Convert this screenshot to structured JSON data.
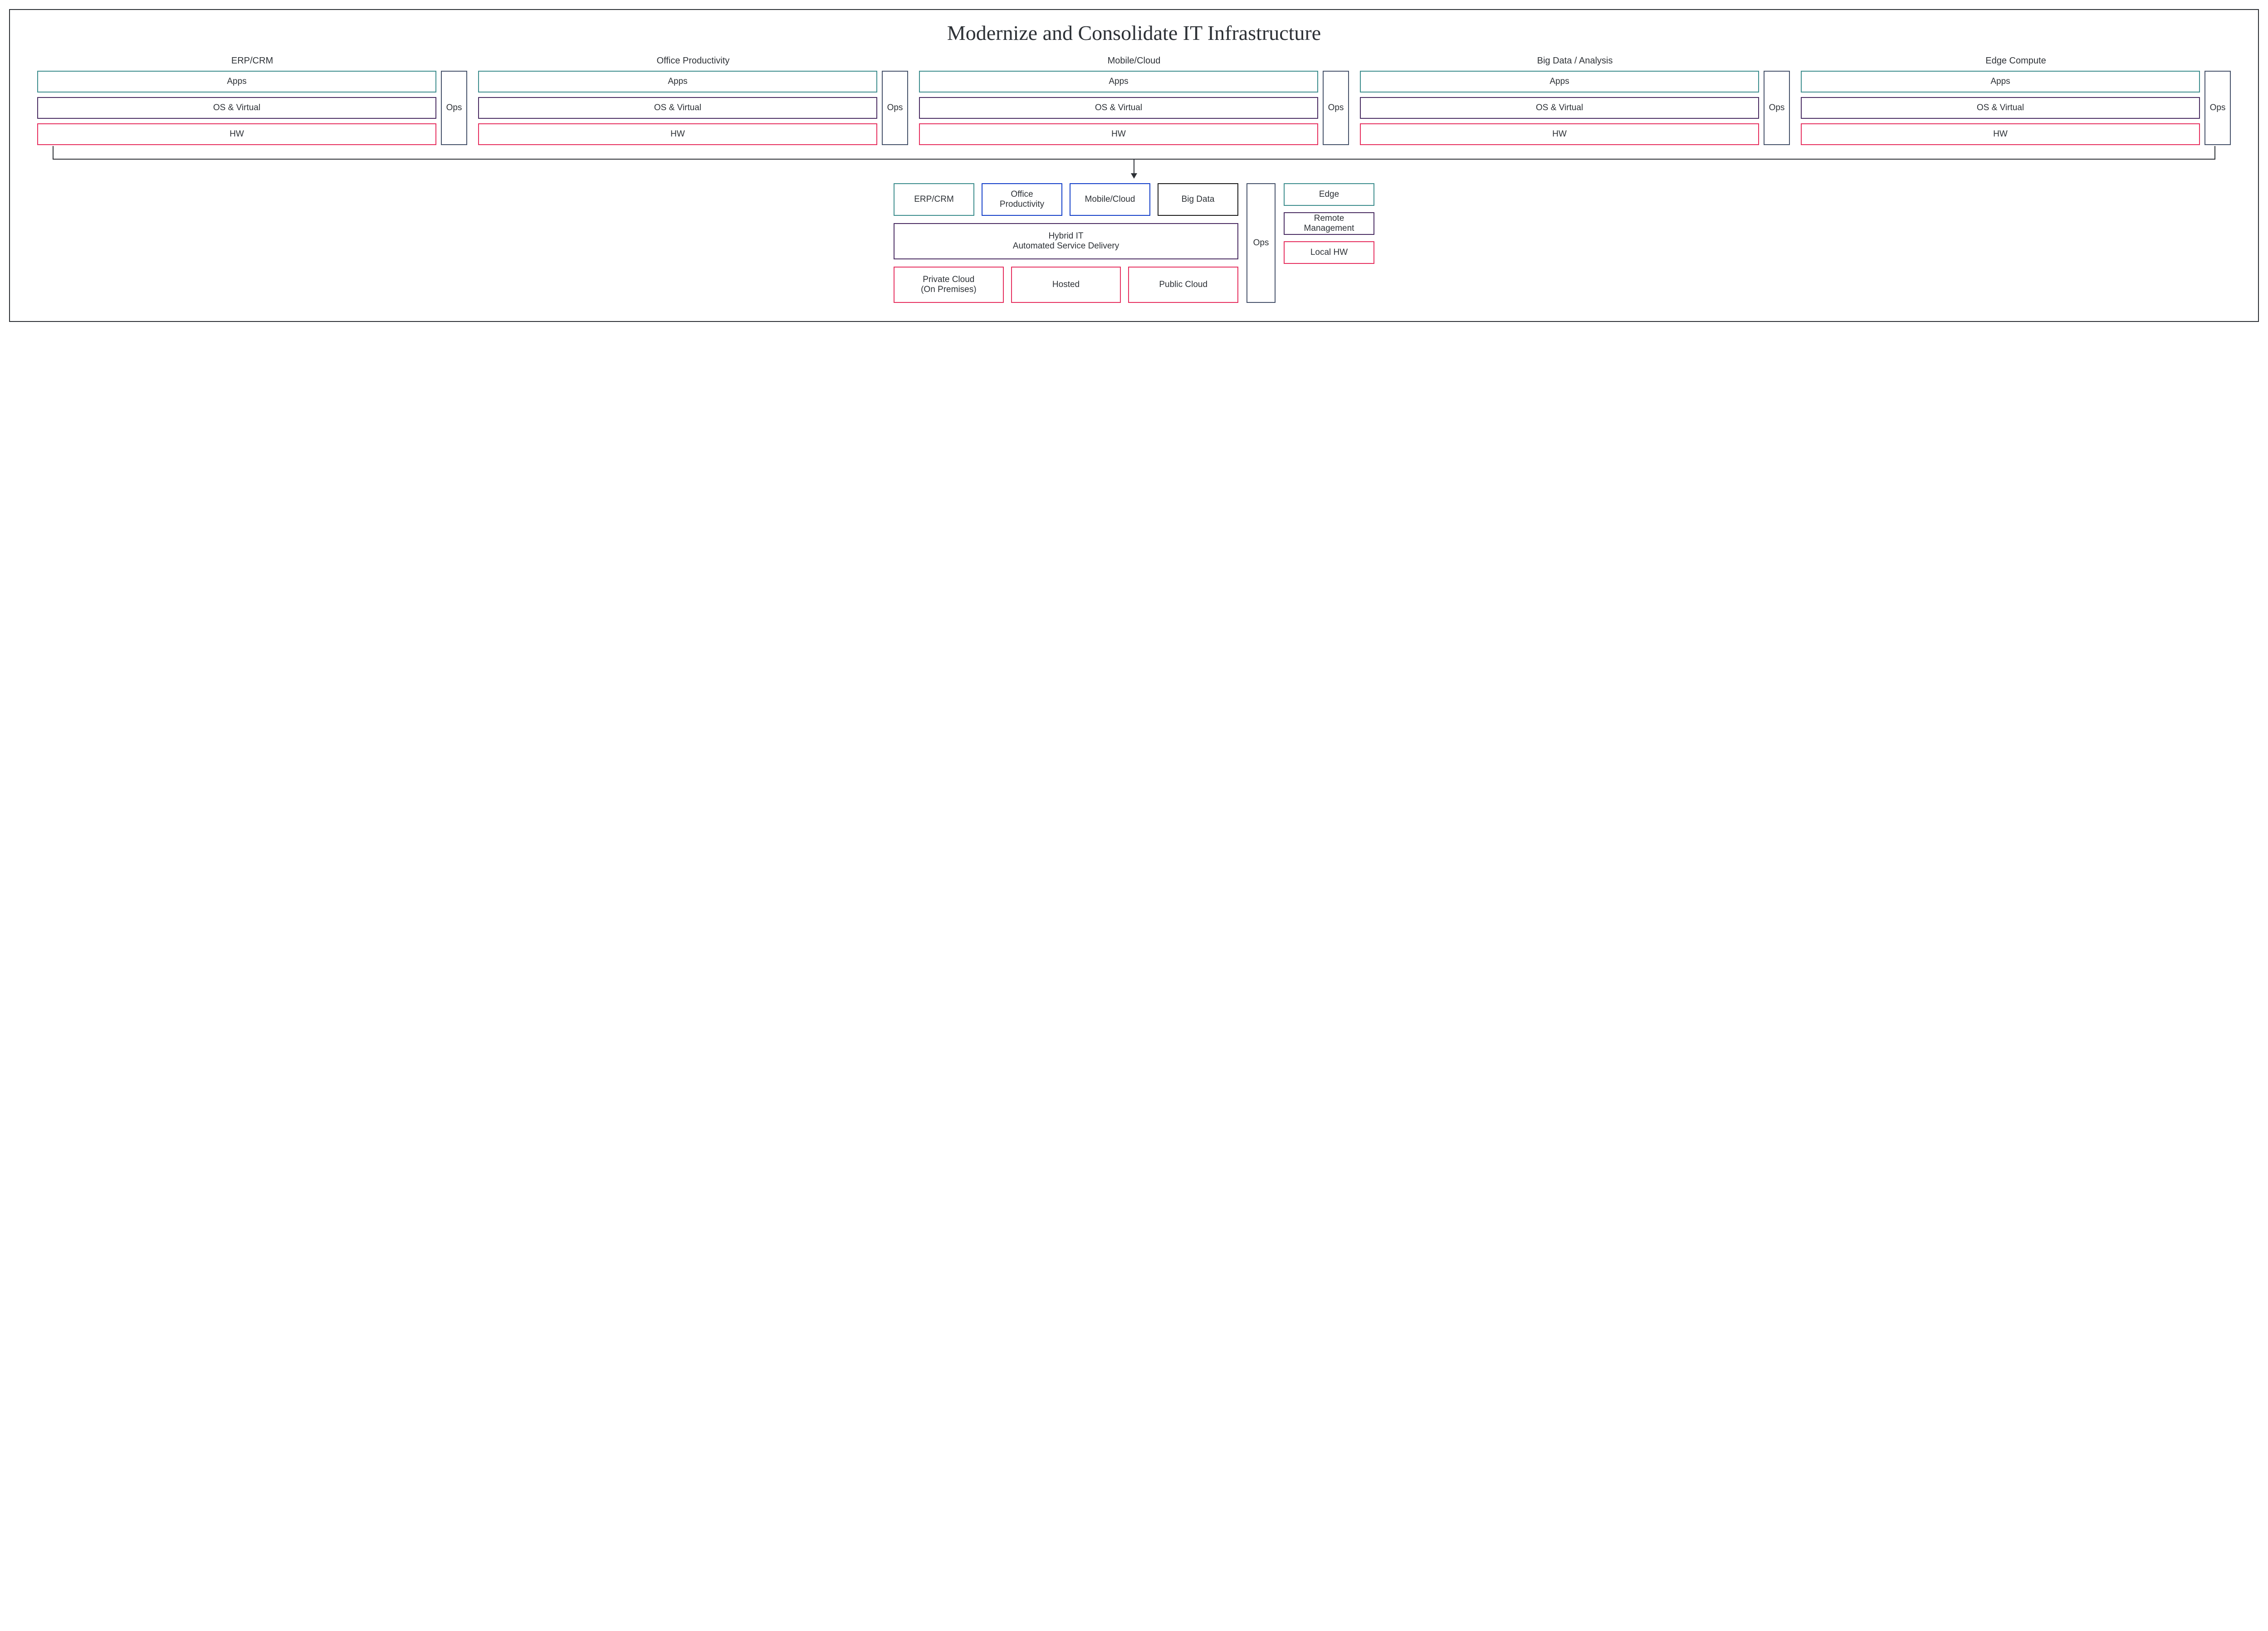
{
  "title": "Modernize and Consolidate IT Infrastructure",
  "silos": [
    {
      "title": "ERP/CRM",
      "apps": "Apps",
      "os": "OS & Virtual",
      "hw": "HW",
      "ops": "Ops"
    },
    {
      "title": "Office Productivity",
      "apps": "Apps",
      "os": "OS & Virtual",
      "hw": "HW",
      "ops": "Ops"
    },
    {
      "title": "Mobile/Cloud",
      "apps": "Apps",
      "os": "OS & Virtual",
      "hw": "HW",
      "ops": "Ops"
    },
    {
      "title": "Big Data / Analysis",
      "apps": "Apps",
      "os": "OS & Virtual",
      "hw": "HW",
      "ops": "Ops"
    },
    {
      "title": "Edge Compute",
      "apps": "Apps",
      "os": "OS & Virtual",
      "hw": "HW",
      "ops": "Ops"
    }
  ],
  "bottom": {
    "apps": [
      {
        "label": "ERP/CRM",
        "color": "teal"
      },
      {
        "label": "Office\nProductivity",
        "color": "blue"
      },
      {
        "label": "Mobile/Cloud",
        "color": "blue"
      },
      {
        "label": "Big Data",
        "color": "black"
      }
    ],
    "hybrid": "Hybrid IT\nAutomated Service Delivery",
    "infra": [
      {
        "label": "Private Cloud\n(On Premises)"
      },
      {
        "label": "Hosted"
      },
      {
        "label": "Public Cloud"
      }
    ],
    "ops": "Ops",
    "edge": [
      {
        "label": "Edge",
        "color": "teal"
      },
      {
        "label": "Remote\nManagement",
        "color": "purple"
      },
      {
        "label": "Local HW",
        "color": "magenta"
      }
    ]
  }
}
